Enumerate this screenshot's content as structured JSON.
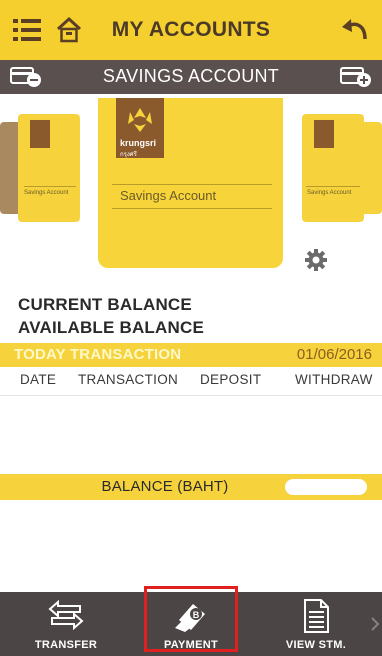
{
  "header": {
    "title": "MY ACCOUNTS",
    "left_icons": [
      "menu-icon",
      "home-icon"
    ],
    "right_icon": "back-arrow-icon"
  },
  "subheader": {
    "title": "SAVINGS ACCOUNT",
    "left_icon": "card-minus-icon",
    "right_icon": "card-plus-icon"
  },
  "cards": {
    "main": {
      "brand": "krungsri",
      "brand_sub": "กรุงศรี",
      "label": "Savings Account"
    },
    "left": {
      "label": "Savings Account"
    },
    "right": {
      "label": "Savings Account"
    }
  },
  "balances": {
    "current_label": "CURRENT BALANCE",
    "available_label": "AVAILABLE BALANCE"
  },
  "today": {
    "label": "TODAY TRANSACTION",
    "date": "01/06/2016"
  },
  "columns": [
    "DATE",
    "TRANSACTION",
    "DEPOSIT",
    "WITHDRAW"
  ],
  "balance_row": {
    "label": "BALANCE (BAHT)"
  },
  "nav": [
    {
      "label": "TRANSFER",
      "icon": "transfer-icon"
    },
    {
      "label": "PAYMENT",
      "icon": "payment-icon"
    },
    {
      "label": "VIEW STM.",
      "icon": "statement-icon"
    }
  ],
  "colors": {
    "accent_yellow": "#f6d33c",
    "dark_bar": "#5b5050",
    "nav_bg": "#4c4545",
    "highlight": "#e21f1f"
  }
}
